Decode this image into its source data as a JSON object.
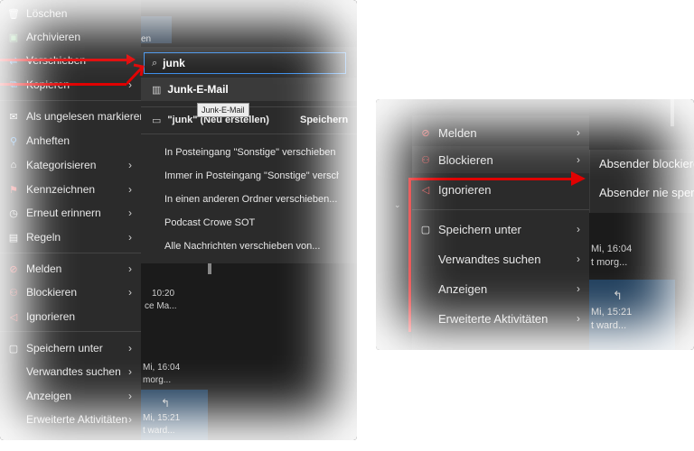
{
  "left_menu": {
    "items": [
      {
        "label": "Löschen",
        "icon": "trash-icon"
      },
      {
        "label": "Archivieren",
        "icon": "archive-icon"
      },
      {
        "label": "Verschieben",
        "icon": "move-icon"
      },
      {
        "label": "Kopieren",
        "icon": "copy-icon"
      },
      {
        "label": "Als ungelesen markieren",
        "icon": "mail-unread-icon"
      },
      {
        "label": "Anheften",
        "icon": "pin-icon"
      },
      {
        "label": "Kategorisieren",
        "icon": "tag-icon"
      },
      {
        "label": "Kennzeichnen",
        "icon": "flag-icon"
      },
      {
        "label": "Erneut erinnern",
        "icon": "clock-icon"
      },
      {
        "label": "Regeln",
        "icon": "rules-icon"
      },
      {
        "label": "Melden",
        "icon": "report-icon"
      },
      {
        "label": "Blockieren",
        "icon": "block-icon"
      },
      {
        "label": "Ignorieren",
        "icon": "mute-icon"
      },
      {
        "label": "Speichern unter",
        "icon": "save-icon"
      },
      {
        "label": "Verwandtes suchen",
        "icon": ""
      },
      {
        "label": "Anzeigen",
        "icon": ""
      },
      {
        "label": "Erweiterte Aktivitäten",
        "icon": ""
      }
    ]
  },
  "move_submenu": {
    "search_value": "junk",
    "result": "Junk-E-Mail",
    "tooltip": "Junk-E-Mail",
    "create_label": "\"junk\" (Neu erstellen)",
    "save_label": "Speichern",
    "actions": [
      "In Posteingang \"Sonstige\" verschieben",
      "Immer in Posteingang \"Sonstige\" verschieben",
      "In einen anderen Ordner verschieben...",
      "Podcast Crowe SOT",
      "Alle Nachrichten verschieben von..."
    ]
  },
  "background_left": {
    "header_text": "en",
    "row1_time": "10:20",
    "row1_preview": "ce Ma...",
    "row2_time": "Mi, 16:04",
    "row2_preview": "morg...",
    "row3_time": "Mi, 15:21",
    "row3_preview": "t ward..."
  },
  "right_menu": {
    "items": [
      {
        "label": "Melden",
        "icon": "report-icon"
      },
      {
        "label": "Blockieren",
        "icon": "block-icon"
      },
      {
        "label": "Ignorieren",
        "icon": "mute-icon"
      },
      {
        "label": "Speichern unter",
        "icon": "save-icon"
      },
      {
        "label": "Verwandtes suchen",
        "icon": ""
      },
      {
        "label": "Anzeigen",
        "icon": ""
      },
      {
        "label": "Erweiterte Aktivitäten",
        "icon": ""
      }
    ],
    "block_submenu": [
      "Absender blockieren",
      "Absender nie sperren"
    ]
  },
  "background_right": {
    "row1_time": "Mi, 16:04",
    "row1_preview": "t morg...",
    "row2_time": "Mi, 15:21",
    "row2_preview": "t ward..."
  },
  "colors": {
    "annotation": "#e00000",
    "menu_bg": "#2b2b2b",
    "accent": "#3b8eea"
  }
}
